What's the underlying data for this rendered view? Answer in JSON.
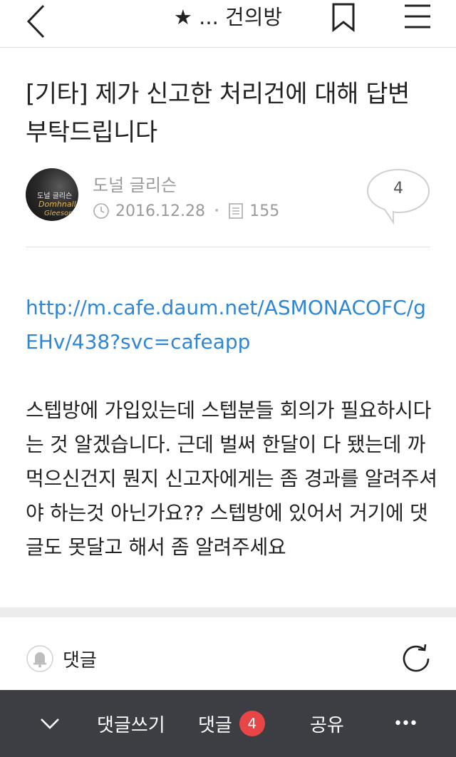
{
  "topbar": {
    "title": "★ ... 건의방",
    "back_icon": "chevron-left-icon",
    "bookmark_icon": "bookmark-icon",
    "menu_icon": "hamburger-menu-icon"
  },
  "post": {
    "title": "[기타] 제가 신고한 처리건에 대해 답변 부탁드립니다",
    "author": "도널 글리슨",
    "date": "2016.12.28",
    "views": "155",
    "comment_count": "4",
    "avatar_text": [
      "도널 글리슨",
      "Domhnall",
      "Gleeson"
    ]
  },
  "body": {
    "link": "http://m.cafe.daum.net/ASMONACOFC/gEHv/438?svc=cafeapp",
    "text": "스텝방에 가입있는데 스텝분들 회의가 필요하시다는 것 알겠습니다. 근데 벌써 한달이 다 됐는데 까먹으신건지 뭔지 신고자에게는 좀 경과를 알려주셔야 하는것 아닌가요?? 스텝방에 있어서 거기에 댓글도 못달고 해서 좀 알려주세요"
  },
  "comments": {
    "label": "댓글"
  },
  "bottombar": {
    "write_comment": "댓글쓰기",
    "comments": "댓글",
    "comment_badge": "4",
    "share": "공유",
    "more": "•••"
  },
  "colors": {
    "link": "#2e86d6",
    "bottombar_bg": "#3d3e44",
    "badge": "#e84646",
    "meta_text": "#9a9a9a"
  }
}
